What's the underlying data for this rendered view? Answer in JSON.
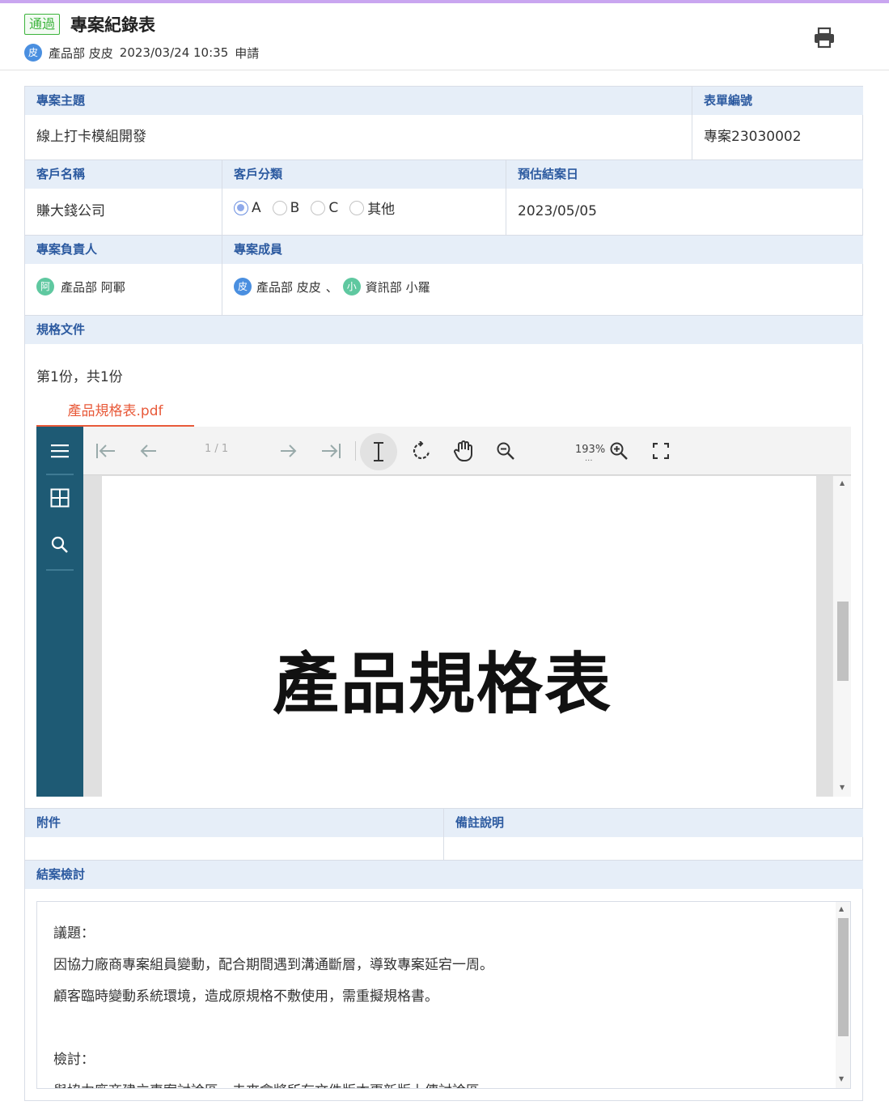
{
  "header": {
    "status_badge": "通過",
    "title": "專案紀錄表",
    "applicant_avatar": "皮",
    "applicant_text": "產品部 皮皮",
    "applicant_datetime": "2023/03/24 10:35",
    "applicant_action": "申請",
    "print_icon": "printer-icon"
  },
  "form": {
    "subject_label": "專案主題",
    "subject_value": "線上打卡模組開發",
    "form_no_label": "表單編號",
    "form_no_value": "專案23030002",
    "customer_label": "客戶名稱",
    "customer_value": "賺大錢公司",
    "category_label": "客戶分類",
    "category_options": [
      "A",
      "B",
      "C",
      "其他"
    ],
    "category_selected": "A",
    "due_label": "預估結案日",
    "due_value": "2023/05/05",
    "owner_label": "專案負責人",
    "owner_avatar": "阿",
    "owner_name": "產品部 阿鄆",
    "members_label": "專案成員",
    "member1_avatar": "皮",
    "member1_name": "產品部 皮皮",
    "member_sep": "、",
    "member2_avatar": "小",
    "member2_name": "資訊部 小羅",
    "spec_label": "規格文件",
    "spec_count": "第1份，共1份",
    "spec_tab": "產品規格表.pdf",
    "attach_label": "附件",
    "notes_label": "備註說明",
    "review_label": "結案檢討",
    "review_lines": [
      "議題：",
      "因協力廠商專案組員變動，配合期間遇到溝通斷層，導致專案延宕一周。",
      "顧客臨時變動系統環境，造成原規格不敷使用，需重擬規格書。",
      "",
      "檢討：",
      "與協力廠商建立專案討論區，未來會將所有文件版本更新版上傳討論區。"
    ]
  },
  "viewer": {
    "page_indicator": "1 / 1",
    "zoom": "193%",
    "zoom_more": "...",
    "pdf_title": "產品規格表"
  }
}
